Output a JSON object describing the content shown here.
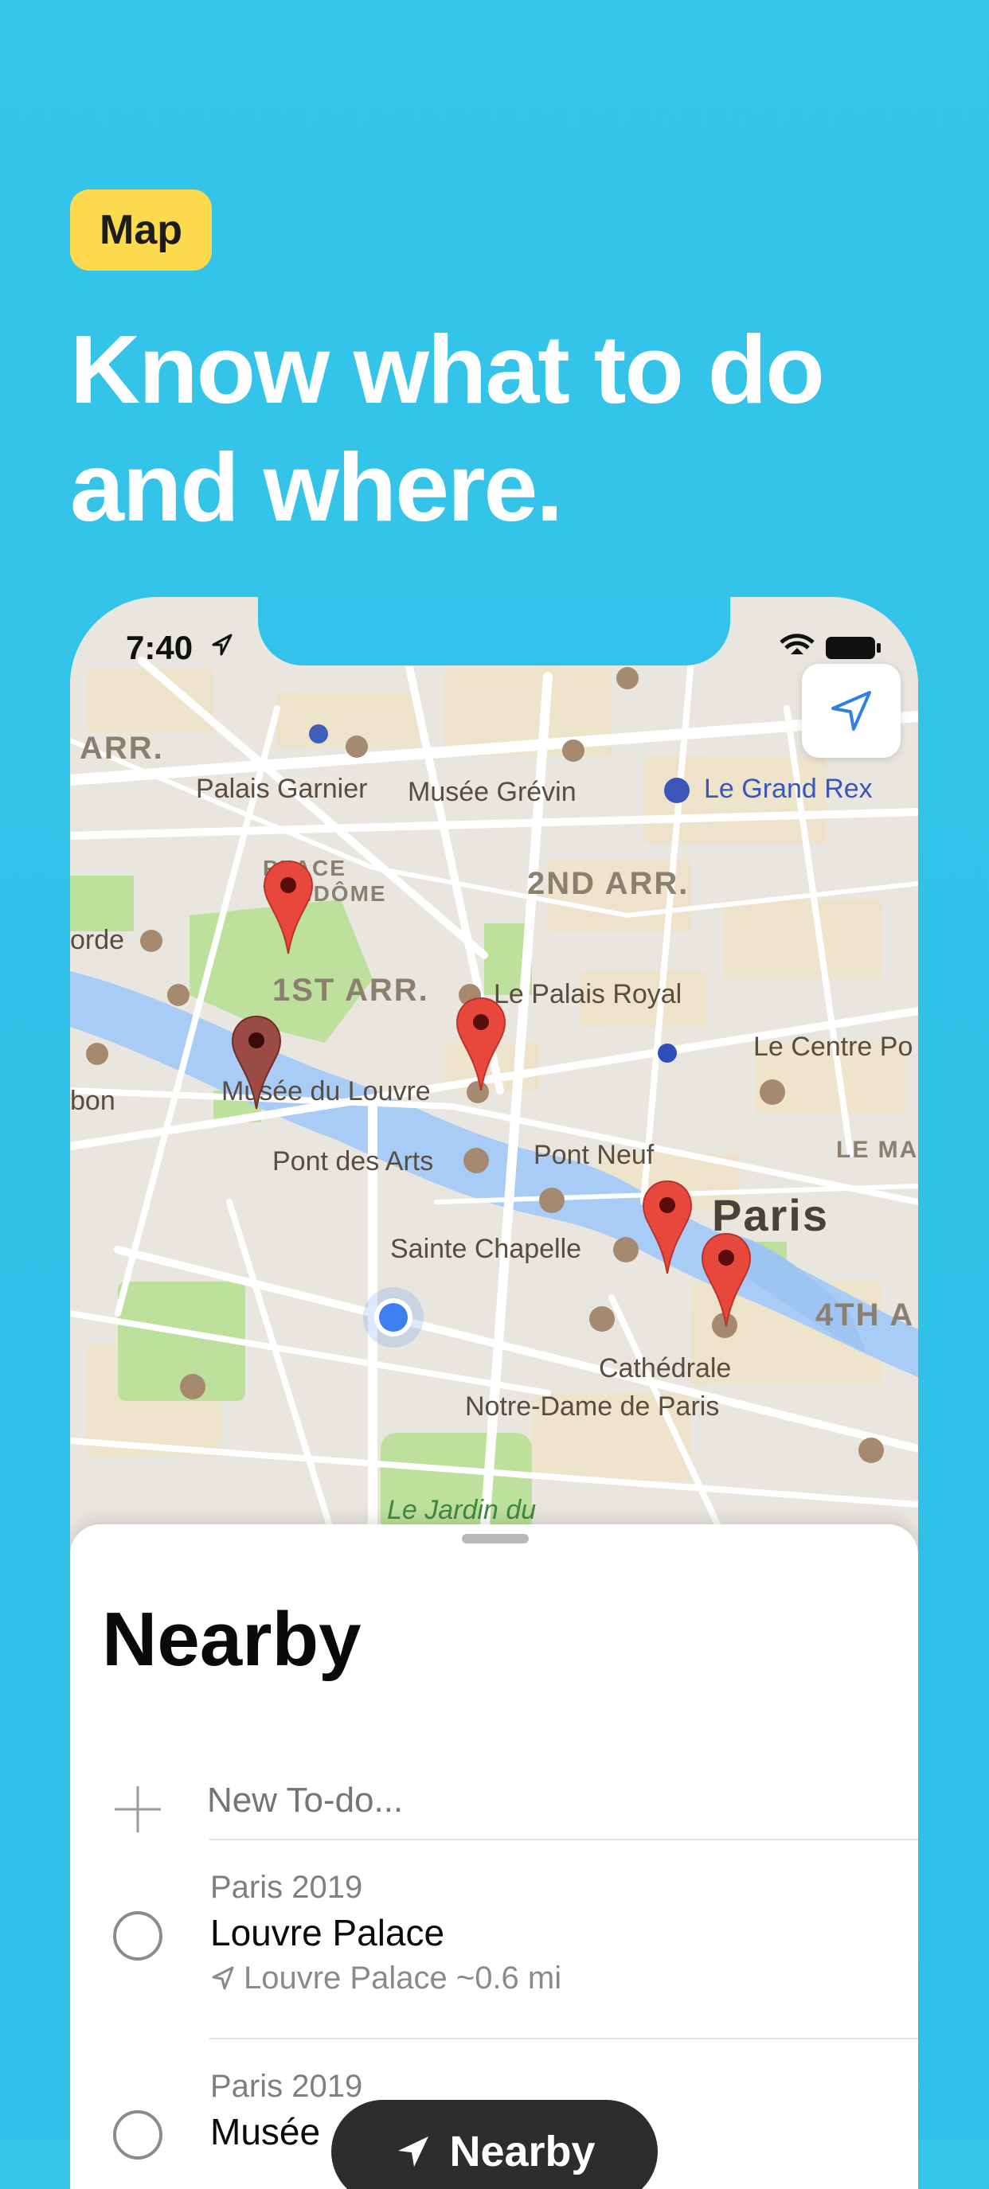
{
  "badge": "Map",
  "headline": {
    "line1": "Know what to do",
    "line2": "and where."
  },
  "status_bar": {
    "time": "7:40"
  },
  "map": {
    "labels": {
      "arr_left": "ARR.",
      "palais_garnier": "Palais Garnier",
      "musee_grevin": "Musée Grévin",
      "le_grand_rex": "Le Grand Rex",
      "place_vendome": "PLACE\nVENDÔME",
      "second_arr": "2ND ARR.",
      "orde": "orde",
      "first_arr": "1ST ARR.",
      "le_palais_royal": "Le Palais Royal",
      "le_centre_po": "Le Centre Po",
      "musee_du_louvre": "Musée du Louvre",
      "bon": "bon",
      "pont_des_arts": "Pont des Arts",
      "pont_neuf": "Pont Neuf",
      "le_ma": "LE MA",
      "paris": "Paris",
      "sainte_chapelle": "Sainte Chapelle",
      "fourth_a": "4TH A",
      "cathedrale": "Cathédrale",
      "notre_dame": "Notre-Dame de Paris",
      "le_jardin_du": "Le Jardin du"
    }
  },
  "sheet": {
    "title": "Nearby",
    "new_todo_placeholder": "New To-do...",
    "items": [
      {
        "category": "Paris 2019",
        "title": "Louvre Palace",
        "meta": "Louvre Palace ~0.6 mi"
      },
      {
        "category": "Paris 2019",
        "title": "Musée"
      }
    ]
  },
  "toast": {
    "label": "Nearby"
  },
  "colors": {
    "background": "#33c3ea",
    "badge": "#fcd94d",
    "pin": "#e8483b",
    "user_dot": "#3e7ff0"
  }
}
